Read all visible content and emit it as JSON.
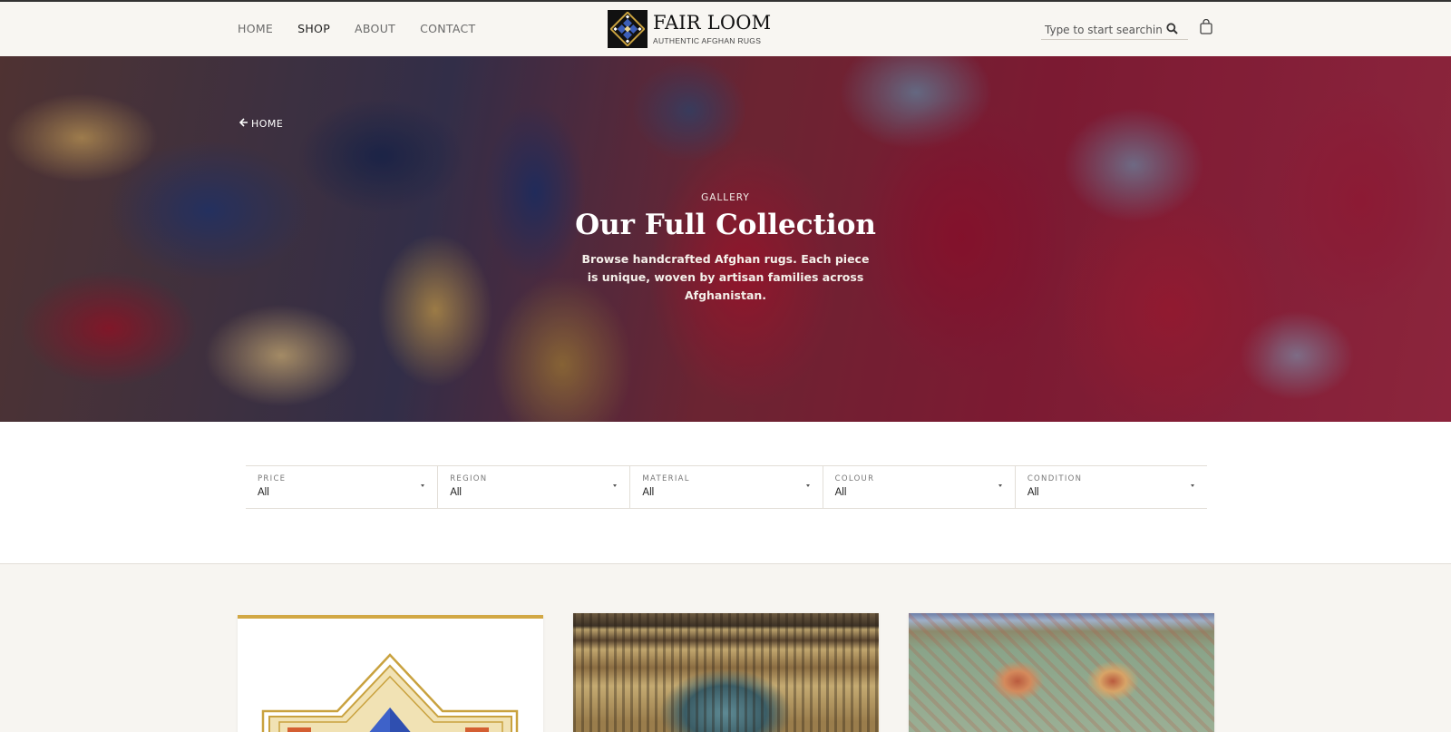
{
  "header": {
    "nav": [
      {
        "label": "HOME",
        "active": false
      },
      {
        "label": "SHOP",
        "active": true
      },
      {
        "label": "ABOUT",
        "active": false
      },
      {
        "label": "CONTACT",
        "active": false
      }
    ],
    "brand_name": "FAIR LOOM",
    "brand_tagline": "AUTHENTIC AFGHAN RUGS",
    "search_placeholder": "Type to start searching",
    "icons": {
      "search": "search-icon",
      "cart": "shopping-bag-icon",
      "logo": "lattice-logo-icon"
    }
  },
  "hero": {
    "back_label": "HOME",
    "eyebrow": "GALLERY",
    "title": "Our Full Collection",
    "description": "Browse handcrafted Afghan rugs. Each piece is unique, woven by artisan families across Afghanistan."
  },
  "filters": [
    {
      "label": "PRICE",
      "value": "All"
    },
    {
      "label": "REGION",
      "value": "All"
    },
    {
      "label": "MATERIAL",
      "value": "All"
    },
    {
      "label": "COLOUR",
      "value": "All"
    },
    {
      "label": "CONDITION",
      "value": "All"
    }
  ],
  "colors": {
    "accent_gold": "#d2a845",
    "hero_red": "#8d1e3a",
    "page_bg": "#f7f5f1"
  }
}
